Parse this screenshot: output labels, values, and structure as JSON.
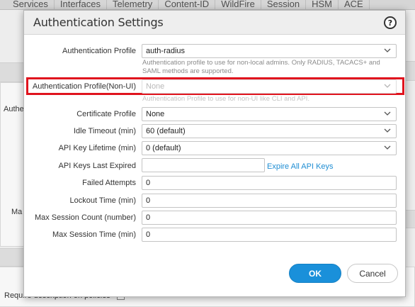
{
  "background": {
    "tabs": [
      "Services",
      "Interfaces",
      "Telemetry",
      "Content-ID",
      "WildFire",
      "Session",
      "HSM",
      "ACE"
    ],
    "fragment_left_1": "Authe",
    "fragment_left_2": "Ma",
    "require_description": "Require description on policies"
  },
  "dialog": {
    "title": "Authentication Settings",
    "help_glyph": "?",
    "fields": {
      "auth_profile": {
        "label": "Authentication Profile",
        "value": "auth-radius",
        "hint": "Authentication profile to use for non-local admins. Only RADIUS, TACACS+ and SAML methods are supported."
      },
      "auth_profile_non_ui": {
        "label": "Authentication Profile(Non-UI)",
        "value": "None",
        "hint": "Authentication Profile to use for non-UI like CLI and API."
      },
      "certificate_profile": {
        "label": "Certificate Profile",
        "value": "None"
      },
      "idle_timeout": {
        "label": "Idle Timeout (min)",
        "value": "60 (default)"
      },
      "api_key_lifetime": {
        "label": "API Key Lifetime (min)",
        "value": "0 (default)"
      },
      "api_keys_last_expired": {
        "label": "API Keys Last Expired",
        "value": "",
        "link": "Expire All API Keys"
      },
      "failed_attempts": {
        "label": "Failed Attempts",
        "value": "0"
      },
      "lockout_time": {
        "label": "Lockout Time (min)",
        "value": "0"
      },
      "max_session_count": {
        "label": "Max Session Count (number)",
        "value": "0"
      },
      "max_session_time": {
        "label": "Max Session Time (min)",
        "value": "0"
      }
    },
    "buttons": {
      "ok": "OK",
      "cancel": "Cancel"
    }
  },
  "colors": {
    "accent": "#1a90da",
    "highlight": "#e0141e",
    "link": "#1e8dd3"
  },
  "icons": {
    "help": "help-icon",
    "dropdown": "chevron-down-icon"
  }
}
